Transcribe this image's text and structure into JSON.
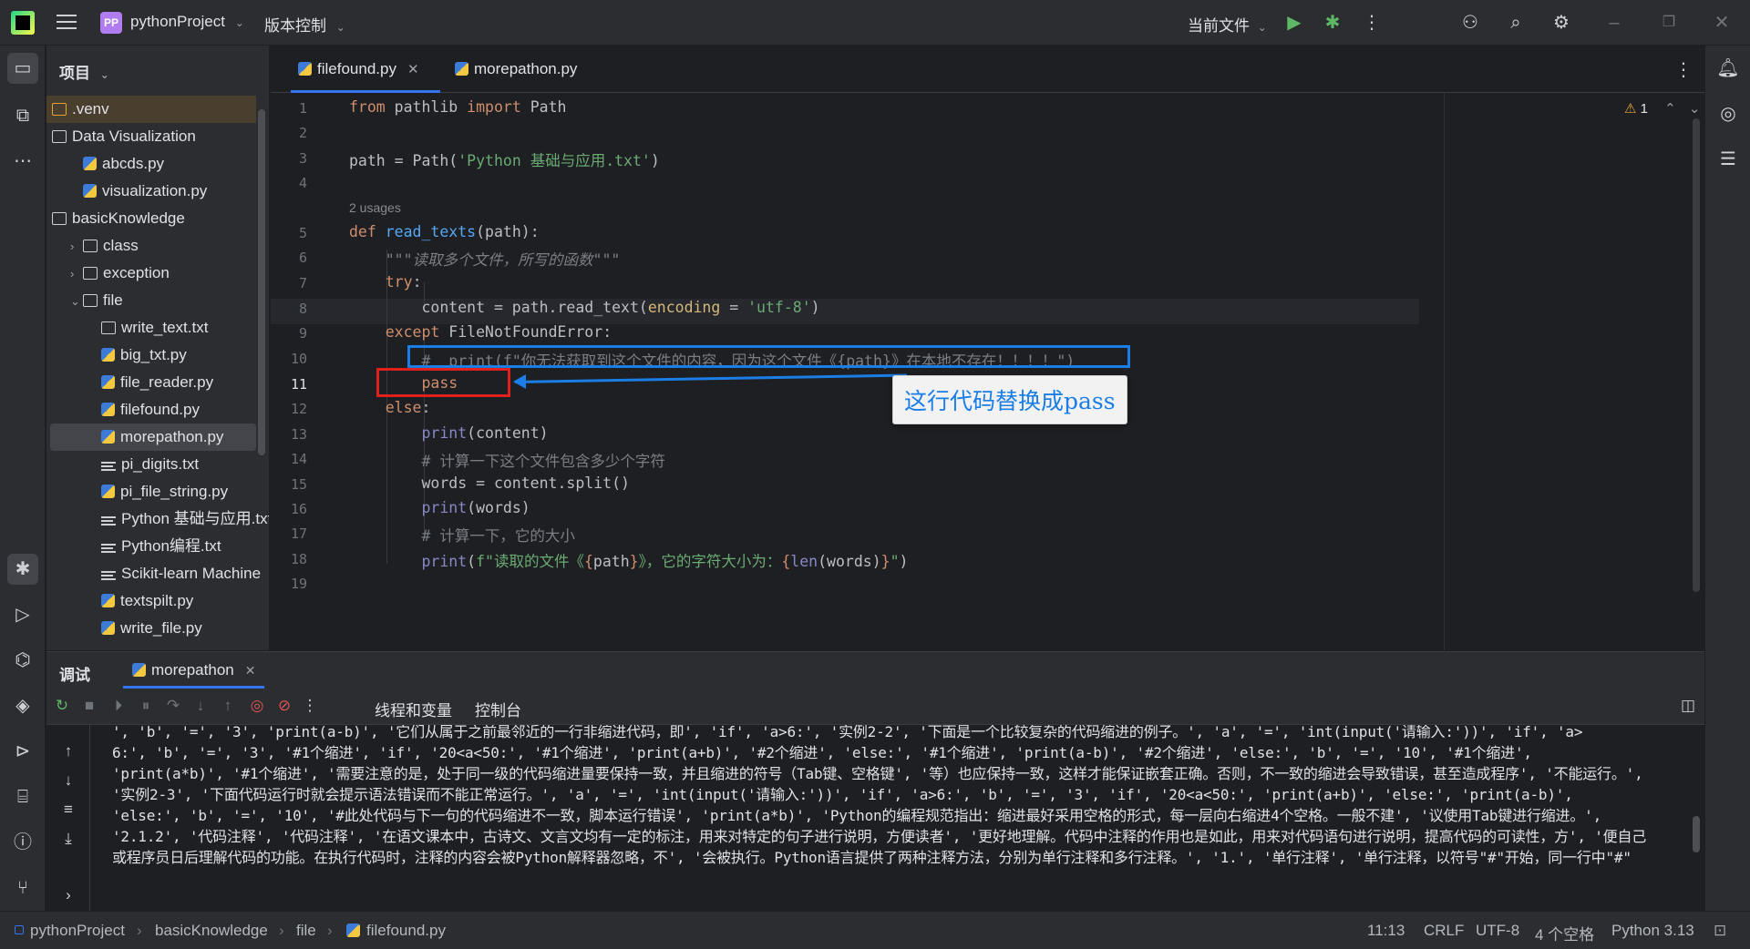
{
  "titlebar": {
    "project_badge": "PP",
    "project_name": "pythonProject",
    "vcs_label": "版本控制",
    "run_config": "当前文件"
  },
  "project_panel": {
    "title": "项目",
    "items": [
      {
        "label": ".venv",
        "type": "folder-orange",
        "indent": 0
      },
      {
        "label": "Data Visualization",
        "type": "folder",
        "indent": 0
      },
      {
        "label": "abcds.py",
        "type": "py",
        "indent": 1
      },
      {
        "label": "visualization.py",
        "type": "py",
        "indent": 1
      },
      {
        "label": "basicKnowledge",
        "type": "folder",
        "indent": 0
      },
      {
        "label": "class",
        "type": "folder",
        "indent": 1,
        "chevron": ">"
      },
      {
        "label": "exception",
        "type": "folder",
        "indent": 1,
        "chevron": ">"
      },
      {
        "label": "file",
        "type": "folder",
        "indent": 1,
        "chevron": "v"
      },
      {
        "label": "write_text.txt",
        "type": "folder",
        "indent": 2
      },
      {
        "label": "big_txt.py",
        "type": "py",
        "indent": 2
      },
      {
        "label": "file_reader.py",
        "type": "py",
        "indent": 2
      },
      {
        "label": "filefound.py",
        "type": "py",
        "indent": 2
      },
      {
        "label": "morepathon.py",
        "type": "py",
        "indent": 2,
        "selected": true
      },
      {
        "label": "pi_digits.txt",
        "type": "txt",
        "indent": 2
      },
      {
        "label": "pi_file_string.py",
        "type": "py",
        "indent": 2
      },
      {
        "label": "Python 基础与应用.txt",
        "type": "txt",
        "indent": 2
      },
      {
        "label": "Python编程.txt",
        "type": "txt",
        "indent": 2
      },
      {
        "label": "Scikit-learn Machine",
        "type": "txt",
        "indent": 2
      },
      {
        "label": "textspilt.py",
        "type": "py",
        "indent": 2
      },
      {
        "label": "write_file.py",
        "type": "py",
        "indent": 2
      }
    ]
  },
  "editor": {
    "tabs": [
      {
        "label": "filefound.py",
        "active": true
      },
      {
        "label": "morepathon.py",
        "active": false
      }
    ],
    "warnings": "1",
    "usages_hint": "2 usages",
    "current_line": "11",
    "callout": "这行代码替换成pass",
    "line_numbers": [
      "1",
      "2",
      "3",
      "4",
      "5",
      "6",
      "7",
      "8",
      "9",
      "10",
      "11",
      "12",
      "13",
      "14",
      "15",
      "16",
      "17",
      "18",
      "19"
    ]
  },
  "debug": {
    "tab_label": "调试",
    "session_label": "morepathon",
    "threads_label": "线程和变量",
    "console_label": "控制台",
    "console_lines": [
      "', 'b', '=', '3', 'print(a-b)', '它们从属于之前最邻近的一行非缩进代码，即', 'if', 'a>6:', '实例2-2', '下面是一个比较复杂的代码缩进的例子。', 'a', '=', 'int(input('请输入:'))', 'if', 'a>",
      "6:', 'b', '=', '3', '#1个缩进', 'if', '20<a<50:', '#1个缩进', 'print(a+b)', '#2个缩进', 'else:', '#1个缩进', 'print(a-b)', '#2个缩进', 'else:', 'b', '=', '10', '#1个缩进',",
      "'print(a*b)', '#1个缩进', '需要注意的是，处于同一级的代码缩进量要保持一致，并且缩进的符号（Tab键、空格键', '等）也应保持一致，这样才能保证嵌套正确。否则，不一致的缩进会导致错误，甚至造成程序', '不能运行。',",
      "'实例2-3', '下面代码运行时就会提示语法错误而不能正常运行。', 'a', '=', 'int(input('请输入:'))', 'if', 'a>6:', 'b', '=', '3', 'if', '20<a<50:', 'print(a+b)', 'else:', 'print(a-b)',",
      "'else:', 'b', '=', '10', '#此处代码与下一句的代码缩进不一致，脚本运行错误', 'print(a*b)', 'Python的编程规范指出：缩进最好采用空格的形式，每一层向右缩进4个空格。一般不建', '议使用Tab键进行缩进。',",
      "'2.1.2', '代码注释', '代码注释', '在语文课本中，古诗文、文言文均有一定的标注，用来对特定的句子进行说明，方便读者', '更好地理解。代码中注释的作用也是如此，用来对代码语句进行说明，提高代码的可读性，方', '便自己",
      "或程序员日后理解代码的功能。在执行代码时，注释的内容会被Python解释器忽略，不', '会被执行。Python语言提供了两种注释方法，分别为单行注释和多行注释。', '1.', '单行注释', '单行注释，以符号\"#\"开始，同一行中\"#\""
    ]
  },
  "statusbar": {
    "crumbs": [
      "pythonProject",
      "basicKnowledge",
      "file",
      "filefound.py"
    ],
    "position": "11:13",
    "line_sep": "CRLF",
    "encoding": "UTF-8",
    "indent": "4 个空格",
    "interpreter": "Python 3.13"
  }
}
